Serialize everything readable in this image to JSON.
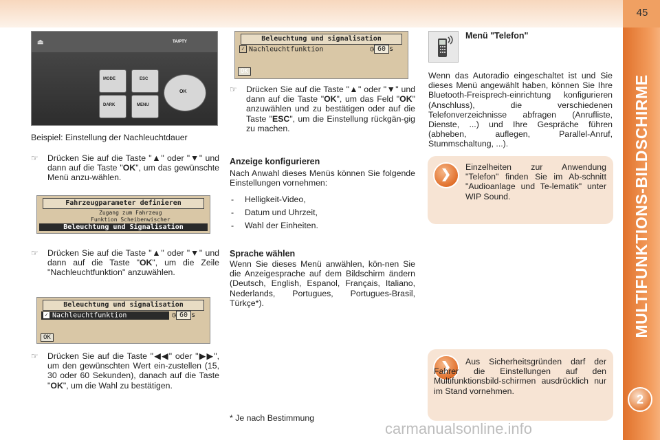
{
  "page_number": "45",
  "section_title": "MULTIFUNKTIONS-BILDSCHIRME",
  "chapter_number": "2",
  "col1": {
    "panel_labels": {
      "ta_pty": "TA/PTY",
      "mode": "MODE",
      "esc": "ESC",
      "ok": "OK",
      "dark": "DARK",
      "menu": "MENU"
    },
    "caption": "Beispiel: Einstellung der Nachleuchtdauer",
    "step1": {
      "pre": "Drücken Sie auf die Taste \"▲\" oder \"▼\" und dann auf die Taste \"",
      "key": "OK",
      "post": "\", um das gewünschte Menü anzu-wählen."
    },
    "screen1": {
      "title": "Fahrzeugparameter definieren",
      "items": [
        "Zugang zum Fahrzeug",
        "Funktion Scheibenwischer",
        "Beleuchtung und Signalisation"
      ]
    },
    "step2": {
      "pre": "Drücken Sie auf die Taste \"▲\" oder \"▼\" und dann auf die Taste \"",
      "key": "OK",
      "post": "\", um die Zeile \"Nachleuchtfunktion\" anzuwählen."
    },
    "screen2": {
      "title": "Beleuchtung und signalisation",
      "row": "Nachleuchtfunktion",
      "value": "60",
      "unit": "s",
      "ok": "OK"
    },
    "step3": {
      "pre": "Drücken Sie auf die Taste \"◀◀\" oder \"▶▶\", um den gewünschten Wert ein-zustellen (15, 30 oder 60 Sekunden), danach auf die Taste \"",
      "key": "OK",
      "post": "\", um die Wahl zu bestätigen."
    }
  },
  "col2": {
    "screen3": {
      "title": "Beleuchtung und signalisation",
      "row": "Nachleuchtfunktion",
      "value": "60",
      "unit": "s",
      "ok": "OK"
    },
    "step4": {
      "pre": "Drücken Sie auf die Taste \"▲\" oder \"▼\" und dann auf die Taste \"",
      "key": "OK",
      "mid": "\", um das Feld \"",
      "key2": "OK",
      "mid2": "\" anzuwählen und zu bestätigen oder auf die Taste \"",
      "key3": "ESC",
      "post": "\", um die Einstellung rückgän-gig zu machen."
    },
    "anzeige_heading": "Anzeige konfigurieren",
    "anzeige_text": "Nach Anwahl dieses Menüs können Sie folgende Einstellungen vornehmen:",
    "anzeige_items": [
      "Helligkeit-Video,",
      "Datum und Uhrzeit,",
      "Wahl der Einheiten."
    ],
    "sprache_heading": "Sprache wählen",
    "sprache_text": "Wenn Sie dieses Menü anwählen, kön-nen Sie die Anzeigesprache auf dem Bildschirm ändern (Deutsch, English, Espanol, Français, Italiano, Nederlands, Portugues, Portugues-Brasil, Türkçe*).",
    "footnote": "* Je nach Bestimmung"
  },
  "col3": {
    "telefon_heading": "Menü \"Telefon\"",
    "telefon_text": "Wenn das Autoradio eingeschaltet ist und Sie dieses Menü angewählt haben, können Sie Ihre Bluetooth-Freisprech-einrichtung konfigurieren (Anschluss), die verschiedenen Telefonverzeichnisse abfragen (Anrufliste, Dienste, ...) und Ihre Gespräche führen (abheben, auflegen, Parallel-Anruf, Stummschaltung, ...).",
    "info1": "Einzelheiten zur Anwendung \"Telefon\" finden Sie im Ab-schnitt \"Audioanlage und Te-lematik\" unter WIP Sound.",
    "info2": "Aus Sicherheitsgründen darf der Fahrer die Einstellungen auf den Multifunktionsbild-schirmen ausdrücklich nur im Stand vornehmen."
  },
  "watermark": "carmanualsonline.info"
}
